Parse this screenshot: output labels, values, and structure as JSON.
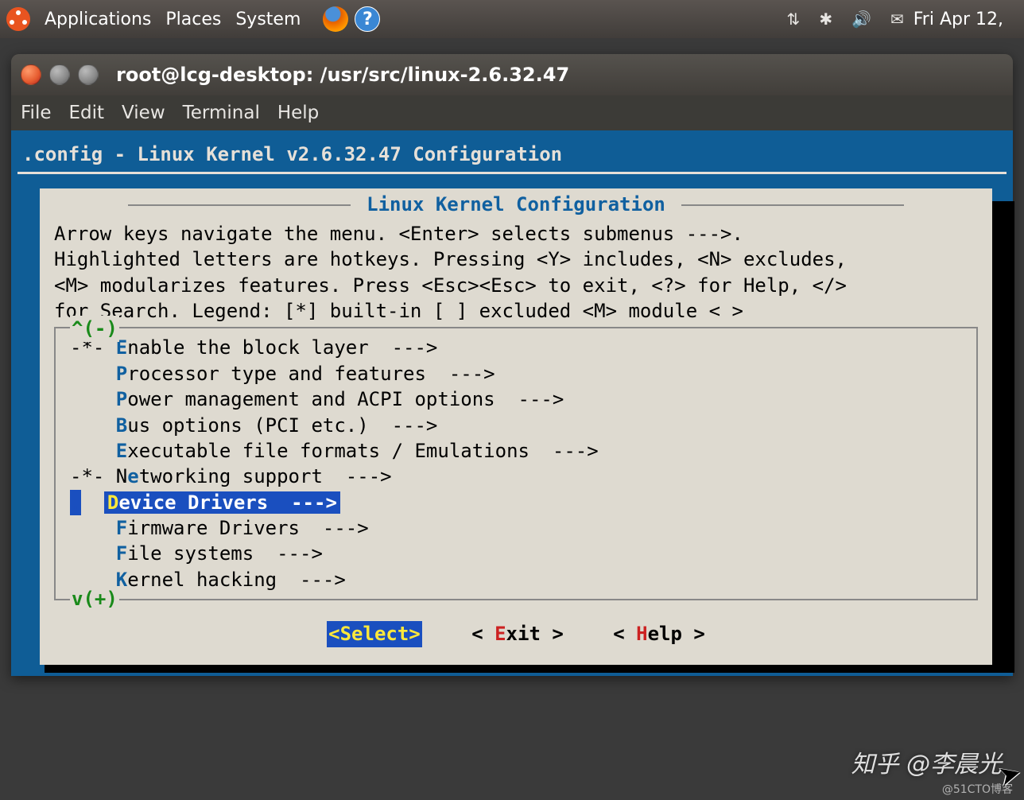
{
  "panel": {
    "menus": [
      "Applications",
      "Places",
      "System"
    ],
    "clock": "Fri Apr 12,"
  },
  "window": {
    "title": "root@lcg-desktop: /usr/src/linux-2.6.32.47",
    "menus": [
      "File",
      "Edit",
      "View",
      "Terminal",
      "Help"
    ]
  },
  "config": {
    "header": ".config - Linux Kernel v2.6.32.47 Configuration",
    "dialog_title": "Linux Kernel Configuration",
    "help_lines": [
      "Arrow keys navigate the menu.  <Enter> selects submenus --->.",
      "Highlighted letters are hotkeys.  Pressing <Y> includes, <N> excludes,",
      "<M> modularizes features.  Press <Esc><Esc> to exit, <?> for Help, </>",
      "for Search.  Legend: [*] built-in  [ ] excluded  <M> module  < >"
    ],
    "scroll_top": "^(-)",
    "scroll_bot": "v(+)",
    "items": [
      {
        "prefix": "-*- ",
        "hot": "E",
        "rest": "nable the block layer  --->"
      },
      {
        "prefix": "    ",
        "hot": "P",
        "rest": "rocessor type and features  --->"
      },
      {
        "prefix": "    ",
        "hot": "P",
        "rest": "ower management and ACPI options  --->"
      },
      {
        "prefix": "    ",
        "hot": "B",
        "rest": "us options (PCI etc.)  --->"
      },
      {
        "prefix": "    ",
        "hot": "E",
        "rest": "xecutable file formats / Emulations  --->"
      },
      {
        "prefix": "-*- N",
        "hot": "e",
        "rest": "tworking support  --->"
      },
      {
        "prefix": "    ",
        "hot": "D",
        "rest": "evice Drivers  --->",
        "selected": true
      },
      {
        "prefix": "    ",
        "hot": "F",
        "rest": "irmware Drivers  --->"
      },
      {
        "prefix": "    ",
        "hot": "F",
        "rest": "ile systems  --->"
      },
      {
        "prefix": "    ",
        "hot": "K",
        "rest": "ernel hacking  --->"
      }
    ],
    "buttons": {
      "select": "<Select>",
      "exit_pre": "< ",
      "exit_hot": "E",
      "exit_rest": "xit >",
      "help_pre": "< ",
      "help_hot": "H",
      "help_rest": "elp >"
    }
  },
  "watermark": "知乎 @李晨光",
  "watermark2": "@51CTO博客"
}
